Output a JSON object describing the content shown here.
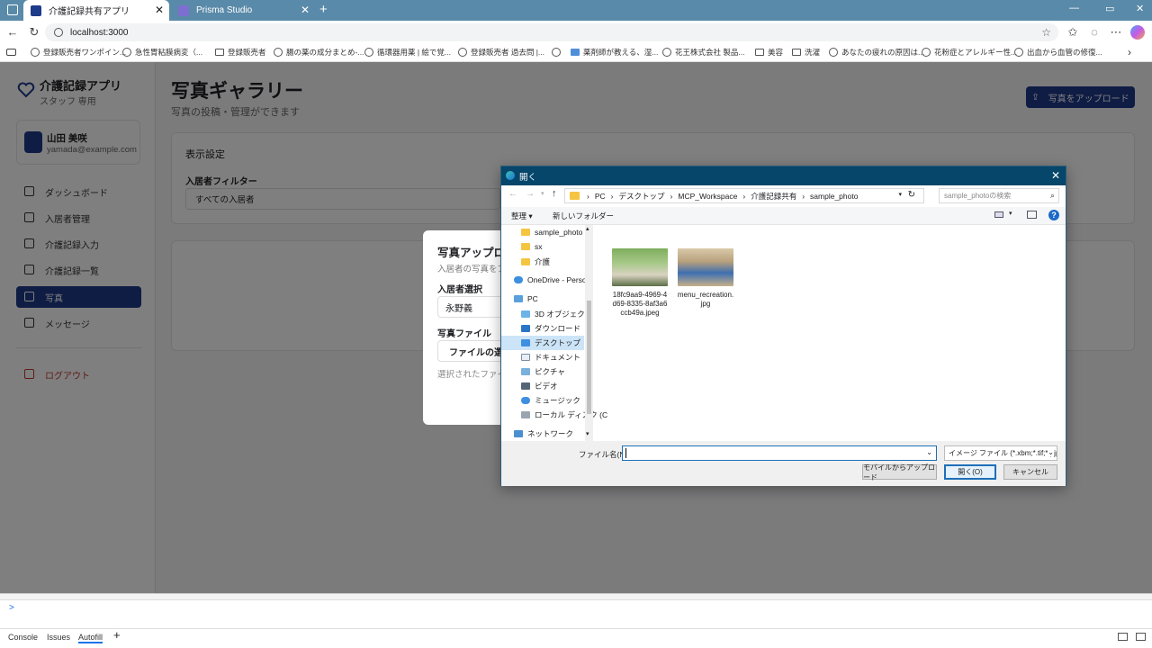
{
  "browser": {
    "tabs": [
      {
        "label": "介護記録共有アプリ",
        "active": true
      },
      {
        "label": "Prisma Studio",
        "active": false
      }
    ],
    "new_tab": "+",
    "url": "localhost:3000",
    "bookmarks": [
      "登録販売者ワンポイン...",
      "急性胃粘膜病変（...",
      "登録販売者",
      "腸の薬の成分まとめ-...",
      "循環器用薬 | 絵で覚...",
      "登録販売者 過去問 |...",
      "薬剤師が教える、湿...",
      "花王株式会社 製品...",
      "美容",
      "洗濯",
      "あなたの疲れの原因は...",
      "花粉症とアレルギー性...",
      "出血から血管の修復..."
    ]
  },
  "app": {
    "logo_title": "介護記録アプリ",
    "logo_sub": "スタッフ 専用",
    "user": {
      "name": "山田 美咲",
      "email": "yamada@example.com"
    },
    "nav": [
      {
        "label": "ダッシュボード",
        "icon": "user-icon"
      },
      {
        "label": "入居者管理",
        "icon": "users-icon"
      },
      {
        "label": "介護記録入力",
        "icon": "document-icon"
      },
      {
        "label": "介護記録一覧",
        "icon": "list-icon"
      },
      {
        "label": "写真",
        "icon": "camera-icon",
        "active": true
      },
      {
        "label": "メッセージ",
        "icon": "message-icon"
      }
    ],
    "logout": "ログアウト",
    "title": "写真ギャラリー",
    "subtitle": "写真の投稿・管理ができます",
    "upload_button": "写真をアップロード",
    "settings_title": "表示設定",
    "filter_label": "入居者フィルター",
    "filter_value": "すべての入居者"
  },
  "modal": {
    "title": "写真アップロ",
    "subtitle": "入居者の写真をア",
    "resident_label": "入居者選択",
    "resident_value": "永野義",
    "file_label": "写真ファイル",
    "file_button": "ファイルの選",
    "selected_note": "選択されたファイ"
  },
  "dialog": {
    "title": "開く",
    "path": [
      "PC",
      "デスクトップ",
      "MCP_Workspace",
      "介護記録共有",
      "sample_photo"
    ],
    "search_placeholder": "sample_photoの検索",
    "organize": "整理 ▾",
    "new_folder": "新しいフォルダー",
    "tree": [
      {
        "label": "sample_photo",
        "icon": "folder-icon"
      },
      {
        "label": "sx",
        "icon": "folder-icon"
      },
      {
        "label": "介護",
        "icon": "folder-icon"
      },
      {
        "label": "OneDrive - Person",
        "icon": "cloud-icon"
      },
      {
        "label": "PC",
        "icon": "pc-icon"
      },
      {
        "label": "3D オブジェクト",
        "icon": "cube-icon"
      },
      {
        "label": "ダウンロード",
        "icon": "download-icon"
      },
      {
        "label": "デスクトップ",
        "icon": "desktop-icon",
        "selected": true
      },
      {
        "label": "ドキュメント",
        "icon": "document-icon"
      },
      {
        "label": "ピクチャ",
        "icon": "picture-icon"
      },
      {
        "label": "ビデオ",
        "icon": "video-icon"
      },
      {
        "label": "ミュージック",
        "icon": "music-icon"
      },
      {
        "label": "ローカル ディスク (C",
        "icon": "disk-icon"
      },
      {
        "label": "ネットワーク",
        "icon": "network-icon"
      }
    ],
    "files": [
      {
        "name_lines": [
          "18fc9aa9-4969-4",
          "d69-8335-8af3a6",
          "ccb49a.jpeg"
        ]
      },
      {
        "name_lines": [
          "menu_recreation.",
          "jpg"
        ]
      }
    ],
    "filename_label": "ファイル名(N):",
    "filename_value": "",
    "filetype": "イメージ ファイル (*.xbm;*.tif;*.pjp;",
    "mobile_button": "モバイルからアップロード",
    "open_button": "開く(O)",
    "cancel_button": "キャンセル"
  },
  "devtools": {
    "tabs": [
      "Console",
      "Issues",
      "Autofill"
    ],
    "add": "+",
    "prompt": ">"
  }
}
